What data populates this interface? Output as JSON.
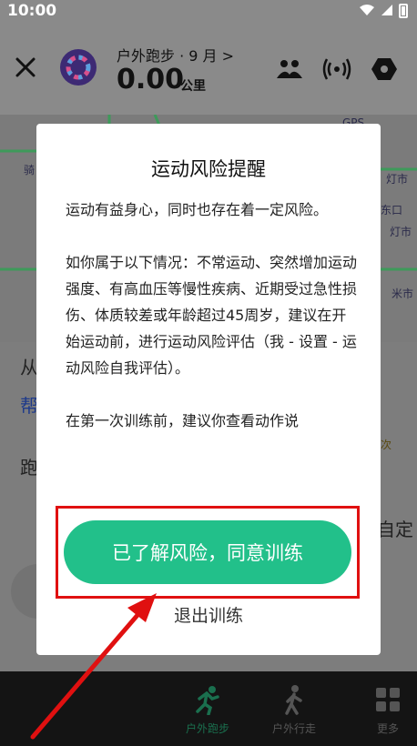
{
  "status_bar": {
    "time": "10:00"
  },
  "top_bar": {
    "run_mode": "户外跑步 · 9 月 >",
    "distance": "0.00",
    "unit": "公里"
  },
  "map": {
    "labels": [
      "GPS",
      "灯市",
      "东口",
      "灯市",
      "米市",
      "米市",
      "骑"
    ]
  },
  "background": {
    "text_from": "从",
    "text_help": "帮",
    "text_run": "跑",
    "text_custom": "自定",
    "badge_times": "次"
  },
  "dialog": {
    "title": "运动风险提醒",
    "paragraphs": [
      "运动有益身心，同时也存在着一定风险。",
      "如你属于以下情况：不常运动、突然增加运动强度、有高血压等慢性疾病、近期受过急性损伤、体质较差或年龄超过45周岁，建议在开始运动前，进行运动风险评估（我 - 设置 - 运动风险自我评估）。",
      "在第一次训练前，建议你查看动作说"
    ],
    "agree_label": "已了解风险，同意训练",
    "exit_label": "退出训练"
  },
  "bottom_nav": {
    "items": [
      {
        "label": "户外跑步",
        "icon": "running-icon"
      },
      {
        "label": "户外行走",
        "icon": "walking-icon"
      },
      {
        "label": "更多",
        "icon": "grid-icon"
      }
    ]
  },
  "colors": {
    "accent": "#22c08a",
    "highlight": "#e01010",
    "overlay": "#7a7a7a"
  }
}
